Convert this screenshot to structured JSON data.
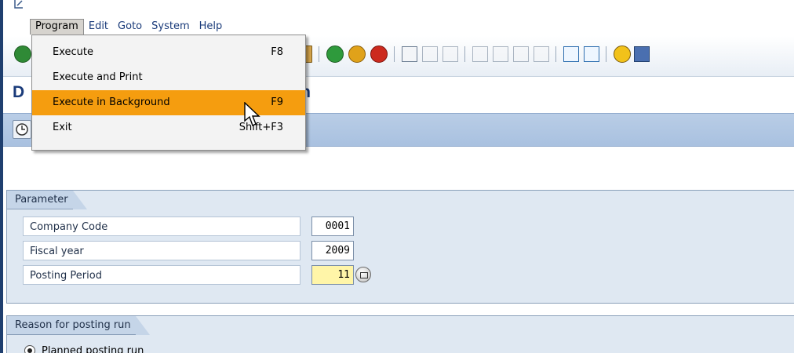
{
  "menubar": {
    "items": [
      {
        "label": "Program"
      },
      {
        "label": "Edit"
      },
      {
        "label": "Goto"
      },
      {
        "label": "System"
      },
      {
        "label": "Help"
      }
    ]
  },
  "program_menu": {
    "items": [
      {
        "label": "Execute",
        "shortcut": "F8"
      },
      {
        "label": "Execute and Print",
        "shortcut": ""
      },
      {
        "label": "Execute in Background",
        "shortcut": "F9"
      },
      {
        "label": "Exit",
        "shortcut": "Shift+F3"
      }
    ],
    "highlight_color": "#f59d0f"
  },
  "title": {
    "visible_start": "D",
    "visible_end": "n"
  },
  "parameter_group": {
    "title": "Parameter",
    "fields": [
      {
        "label": "Company Code",
        "value": "0001"
      },
      {
        "label": "Fiscal year",
        "value": "2009"
      },
      {
        "label": "Posting Period",
        "value": "11"
      }
    ]
  },
  "reason_group": {
    "title": "Reason for posting run",
    "options": [
      {
        "label": "Planned posting run",
        "selected": true
      }
    ]
  },
  "colors": {
    "title": "#1a3b7a",
    "app_toolbar": "#b9cde6",
    "group_bg": "#dfe8f2",
    "required_field": "#fff5a8"
  }
}
